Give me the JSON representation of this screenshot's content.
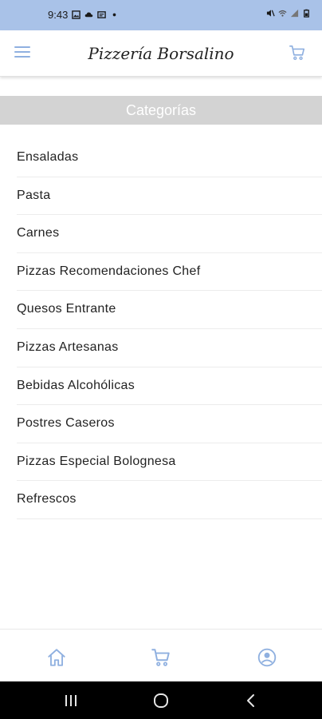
{
  "status_bar": {
    "time": "9:43",
    "left_icons": [
      "image-icon",
      "cloud-icon",
      "cast-icon",
      "dot-icon"
    ],
    "right_icons": [
      "no-sound-icon",
      "wifi-icon",
      "signal-icon",
      "battery-icon"
    ]
  },
  "header": {
    "title": "Pizzería Borsalino",
    "menu_icon": "hamburger-menu-icon",
    "cart_icon": "cart-icon"
  },
  "section": {
    "title": "Categorías"
  },
  "categories": [
    {
      "label": "Ensaladas"
    },
    {
      "label": "Pasta"
    },
    {
      "label": "Carnes"
    },
    {
      "label": "Pizzas Recomendaciones Chef"
    },
    {
      "label": "Quesos Entrante"
    },
    {
      "label": "Pizzas Artesanas"
    },
    {
      "label": "Bebidas Alcohólicas"
    },
    {
      "label": "Postres Caseros"
    },
    {
      "label": "Pizzas Especial Bolognesa"
    },
    {
      "label": "Refrescos"
    }
  ],
  "bottom_nav": {
    "items": [
      {
        "icon": "home-icon"
      },
      {
        "icon": "cart-icon"
      },
      {
        "icon": "user-profile-icon"
      }
    ]
  },
  "colors": {
    "status_bar_bg": "#a9c2e8",
    "accent": "#8fb0e0",
    "section_header_bg": "#d3d3d3"
  }
}
